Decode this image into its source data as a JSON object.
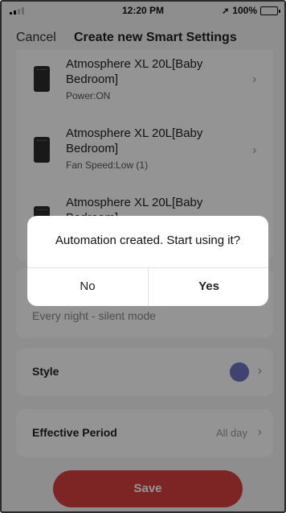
{
  "status_bar": {
    "time": "12:20 PM",
    "battery": "100%"
  },
  "nav": {
    "cancel": "Cancel",
    "title": "Create new Smart Settings"
  },
  "devices": [
    {
      "name": "Atmosphere XL 20L[Baby Bedroom]",
      "detail": "Power:ON"
    },
    {
      "name": "Atmosphere XL 20L[Baby Bedroom]",
      "detail": "Fan Speed:Low (1)"
    },
    {
      "name": "Atmosphere XL 20L[Baby Bedroom]",
      "detail": ""
    }
  ],
  "name_field": {
    "value": "Every night - silent mode"
  },
  "style": {
    "label": "Style",
    "color": "#6f72c0"
  },
  "period": {
    "label": "Effective Period",
    "value": "All day"
  },
  "save_label": "Save",
  "dialog": {
    "message": "Automation created. Start using it?",
    "no": "No",
    "yes": "Yes"
  },
  "colors": {
    "accent": "#d84040",
    "style_dot": "#6f72c0"
  }
}
